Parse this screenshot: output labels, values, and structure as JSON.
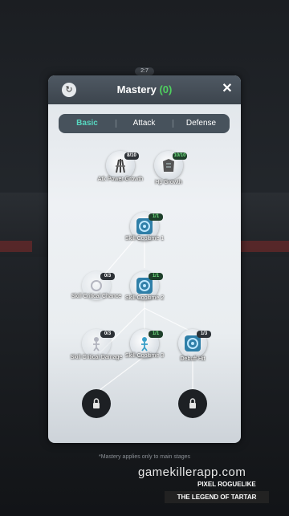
{
  "header": {
    "timer": "2:7",
    "title": "Mastery",
    "points": "(0)",
    "reset_icon": "refresh-icon",
    "close_icon": "close-icon",
    "close_glyph": "✕",
    "reset_glyph": "↻"
  },
  "tabs": [
    {
      "label": "Basic",
      "active": true
    },
    {
      "label": "Attack",
      "active": false
    },
    {
      "label": "Defense",
      "active": false
    }
  ],
  "skills": [
    {
      "label": "Atk Power Growth",
      "level": "8/10",
      "icon": "sword-bundle-icon",
      "state": "partial"
    },
    {
      "label": "Hp Growth",
      "level": "10/10",
      "icon": "armor-icon",
      "state": "maxed"
    },
    {
      "label": "Skill Cooltime 1",
      "level": "1/1",
      "icon": "swirl-icon",
      "state": "maxed"
    },
    {
      "label": "Skill Critical Chance",
      "level": "0/3",
      "icon": "swirl-icon",
      "state": "empty"
    },
    {
      "label": "Skill Cooltime 2",
      "level": "1/1",
      "icon": "swirl-icon",
      "state": "maxed"
    },
    {
      "label": "Skill Critical Damage",
      "level": "0/3",
      "icon": "figure-icon",
      "state": "empty"
    },
    {
      "label": "Skill Cooltime 3",
      "level": "1/1",
      "icon": "figure-icon",
      "state": "maxed"
    },
    {
      "label": "Debuff Hit",
      "level": "1/3",
      "icon": "swirl-icon",
      "state": "partial"
    }
  ],
  "locked_slots": [
    {
      "icon": "lock-icon"
    },
    {
      "icon": "lock-icon"
    }
  ],
  "footer_note": "*Mastery applies only to main stages",
  "watermark": "gamekillerapp.com",
  "game_title_line1": "PIXEL ROGUELIKE",
  "game_title_line2": "THE LEGEND OF TARTAR",
  "colors": {
    "accent": "#57d7c0",
    "points": "#4fd05f",
    "header": "#47525c",
    "badge_green": "#6fe07f"
  }
}
